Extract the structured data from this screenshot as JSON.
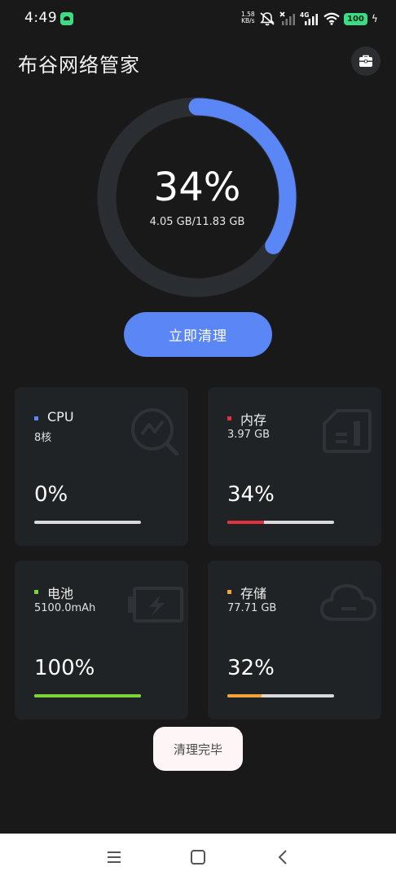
{
  "status_bar": {
    "time": "4:49",
    "net_speed_value": "1.58",
    "net_speed_unit": "KB/s",
    "network_type": "4G",
    "battery_level": "100"
  },
  "header": {
    "title": "布谷网络管家"
  },
  "ring": {
    "percent": "34%",
    "usage_text": "4.05 GB/11.83 GB",
    "fraction": 0.34,
    "track_color": "#2a2d31",
    "progress_color": "#5b86f5"
  },
  "clean_button": {
    "label": "立即清理"
  },
  "cards": {
    "cpu": {
      "name": "CPU",
      "sub": "8核",
      "value": "0%",
      "fraction": 0.0,
      "color": "#5b86f5"
    },
    "memory": {
      "name": "内存",
      "sub": "3.97 GB",
      "value": "34%",
      "fraction": 0.34,
      "color": "#e0313f"
    },
    "battery": {
      "name": "电池",
      "sub": "5100.0mAh",
      "value": "100%",
      "fraction": 1.0,
      "color": "#7bd33a"
    },
    "storage": {
      "name": "存储",
      "sub": "77.71 GB",
      "value": "32%",
      "fraction": 0.32,
      "color": "#f2a33a"
    }
  },
  "toast": {
    "text": "清理完毕"
  },
  "icons": {
    "toolbox": "toolbox-icon",
    "cpu": "cpu-chart-icon",
    "memory": "memory-card-icon",
    "battery": "battery-icon",
    "storage": "cloud-icon"
  }
}
